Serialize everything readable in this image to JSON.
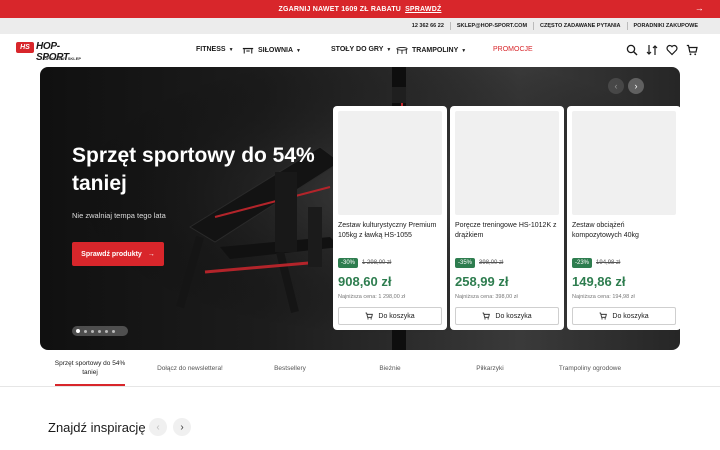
{
  "promo_bar": {
    "text": "ZGARNIJ NAWET 1609 ZŁ RABATU",
    "link": "SPRAWDŹ",
    "arrow": "→"
  },
  "utility_bar": {
    "links": [
      "12 362 66 22",
      "SKLEP@HOP-SPORT.COM",
      "CZĘSTO ZADAWANE PYTANIA",
      "PORADNIKI ZAKUPOWE"
    ]
  },
  "logo": {
    "mark": "HS",
    "word": "HOP-SPORT",
    "subtitle": "OFICJALNY SKLEP"
  },
  "nav": {
    "items": [
      {
        "label": "FITNESS",
        "icon": "none"
      },
      {
        "label": "SIŁOWNIA",
        "icon": "gym-bench-icon"
      },
      {
        "label": "STOŁY DO GRY",
        "icon": "none"
      },
      {
        "label": "TRAMPOLINY",
        "icon": "trampoline-icon"
      },
      {
        "label": "PROMOCJE",
        "icon": "none"
      }
    ],
    "promo_color": "#d8262b"
  },
  "header_icons": [
    "search-icon",
    "compare-icon",
    "heart-icon",
    "cart-icon"
  ],
  "hero": {
    "title": "Sprzęt sportowy do 54% taniej",
    "subtitle": "Nie zwalniaj tempa tego lata",
    "cta_label": "Sprawdź produkty",
    "cta_arrow": "→",
    "slides_total": 6,
    "slide_active": 1,
    "prev_arrow": "‹",
    "next_arrow": "›"
  },
  "products": [
    {
      "title": "Zestaw kulturystyczny Premium 105kg z ławką HS-1055",
      "discount": "-30%",
      "old_price": "1 298,00 zł",
      "price": "908,60 zł",
      "lowest_price": "Najniższa cena: 1 298,00 zł",
      "cart_label": "Do koszyka"
    },
    {
      "title": "Poręcze treningowe HS-1012K z drążkiem",
      "discount": "-35%",
      "old_price": "398,00 zł",
      "price": "258,99 zł",
      "lowest_price": "Najniższa cena: 398,00 zł",
      "cart_label": "Do koszyka"
    },
    {
      "title": "Zestaw obciążeń kompozytowych 40kg",
      "discount": "-23%",
      "old_price": "194,98 zł",
      "price": "149,86 zł",
      "lowest_price": "Najniższa cena: 194,98 zł",
      "cart_label": "Do koszyka"
    }
  ],
  "tabs": [
    {
      "label": "Sprzęt sportowy do 54% taniej",
      "active": true
    },
    {
      "label": "Dołącz do newslettera!",
      "active": false
    },
    {
      "label": "Bestsellery",
      "active": false
    },
    {
      "label": "Bieżnie",
      "active": false
    },
    {
      "label": "Piłkarzyki",
      "active": false
    },
    {
      "label": "Trampoliny ogrodowe",
      "active": false
    }
  ],
  "inspiration": {
    "title": "Znajdź inspirację",
    "prev_arrow": "‹",
    "next_arrow": "›"
  },
  "colors": {
    "brand_red": "#d8262b",
    "discount_green": "#2e7d4f"
  }
}
